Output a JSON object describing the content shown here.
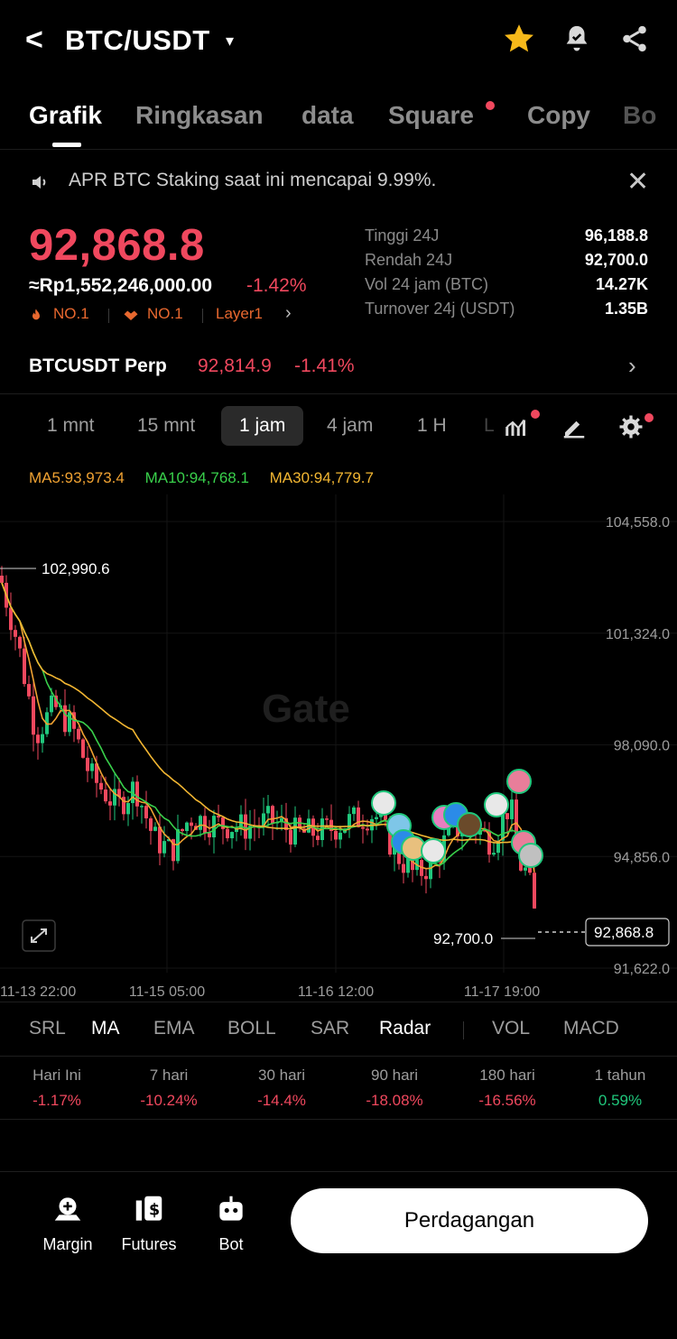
{
  "header": {
    "back": "<",
    "pair": "BTC/USDT",
    "caret": "▾"
  },
  "tabs": [
    "Grafik",
    "Ringkasan",
    "data",
    "Square",
    "Copy",
    "Bo"
  ],
  "announcement": {
    "text": "APR BTC Staking saat ini mencapai 9.99%.",
    "close": "✕"
  },
  "price": {
    "last": "92,868.8",
    "fiat": "≈Rp1,552,246,000.00",
    "change": "-1.42%",
    "badges": [
      "NO.1",
      "NO.1",
      "Layer1"
    ]
  },
  "stats": [
    {
      "label": "Tinggi 24J",
      "value": "96,188.8"
    },
    {
      "label": "Rendah 24J",
      "value": "92,700.0"
    },
    {
      "label": "Vol 24 jam (BTC)",
      "value": "14.27K"
    },
    {
      "label": "Turnover 24j (USDT)",
      "value": "1.35B"
    }
  ],
  "perp": {
    "name": "BTCUSDT Perp",
    "price": "92,814.9",
    "change": "-1.41%",
    "arrow": "›"
  },
  "intervals": [
    "1 mnt",
    "15 mnt",
    "1 jam",
    "4 jam",
    "1 H"
  ],
  "ma_legend": {
    "ma5": "MA5:93,973.4",
    "ma10": "MA10:94,768.1",
    "ma30": "MA30:94,779.7"
  },
  "chart_data": {
    "type": "candlestick",
    "watermark": "Gate",
    "y_ticks": [
      "104,558.0",
      "101,324.0",
      "98,090.0",
      "94,856.0",
      "91,622.0"
    ],
    "y_tick_values": [
      104558.0,
      101324.0,
      98090.0,
      94856.0,
      91622.0
    ],
    "x_ticks": [
      "11-13 22:00",
      "11-15 05:00",
      "11-16 12:00",
      "11-17 19:00"
    ],
    "high_label": "102,990.6",
    "low_label": "92,700.0",
    "last_label": "92,868.8",
    "high": 102990.6,
    "low": 92700.0,
    "last": 92868.8,
    "series_colors": {
      "up": "#20c77c",
      "down": "#f0485e",
      "ma5": "#f0a232",
      "ma10": "#39d04b",
      "ma30": "#f2b632"
    }
  },
  "indicators": [
    "SRL",
    "MA",
    "EMA",
    "BOLL",
    "SAR",
    "Radar",
    "VOL",
    "MACD"
  ],
  "performance": [
    {
      "label": "Hari Ini",
      "value": "-1.17%"
    },
    {
      "label": "7 hari",
      "value": "-10.24%"
    },
    {
      "label": "30 hari",
      "value": "-14.4%"
    },
    {
      "label": "90 hari",
      "value": "-18.08%"
    },
    {
      "label": "180 hari",
      "value": "-16.56%"
    },
    {
      "label": "1 tahun",
      "value": "0.59%"
    }
  ],
  "bottom": {
    "margin": "Margin",
    "futures": "Futures",
    "bot": "Bot",
    "trade": "Perdagangan"
  }
}
